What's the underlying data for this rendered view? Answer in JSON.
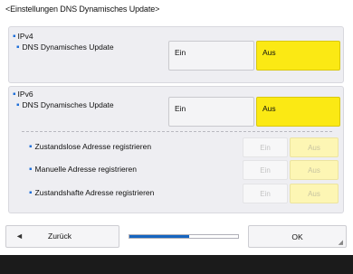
{
  "title": "<Einstellungen DNS Dynamisches Update>",
  "ipv4": {
    "section_label": "IPv4",
    "row_label": "DNS Dynamisches Update",
    "on_label": "Ein",
    "off_label": "Aus",
    "selected": "Aus"
  },
  "ipv6": {
    "section_label": "IPv6",
    "row_label": "DNS Dynamisches Update",
    "on_label": "Ein",
    "off_label": "Aus",
    "selected": "Aus",
    "sub_rows": [
      {
        "label": "Zustandslose Adresse registrieren",
        "on_label": "Ein",
        "off_label": "Aus",
        "selected": "Aus",
        "enabled": false
      },
      {
        "label": "Manuelle Adresse registrieren",
        "on_label": "Ein",
        "off_label": "Aus",
        "selected": "Aus",
        "enabled": false
      },
      {
        "label": "Zustandshafte Adresse registrieren",
        "on_label": "Ein",
        "off_label": "Aus",
        "selected": "Aus",
        "enabled": false
      }
    ]
  },
  "footer": {
    "back_label": "Zurück",
    "ok_label": "OK",
    "progress_fraction": 0.55
  },
  "colors": {
    "selected": "#fbe914",
    "bullet": "#1e6fd9",
    "progress": "#1565c0",
    "bottom_bar": "#1b1b1b"
  }
}
